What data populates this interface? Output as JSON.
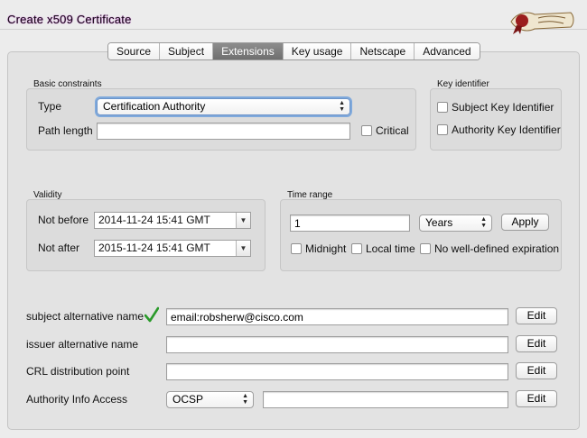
{
  "window": {
    "title": "Create x509 Certificate"
  },
  "tabs": [
    {
      "label": "Source",
      "active": false
    },
    {
      "label": "Subject",
      "active": false
    },
    {
      "label": "Extensions",
      "active": true
    },
    {
      "label": "Key usage",
      "active": false
    },
    {
      "label": "Netscape",
      "active": false
    },
    {
      "label": "Advanced",
      "active": false
    }
  ],
  "basic_constraints": {
    "title": "Basic constraints",
    "type_label": "Type",
    "type_value": "Certification Authority",
    "path_length_label": "Path length",
    "path_length_value": "",
    "critical_label": "Critical",
    "critical_checked": false
  },
  "key_identifier": {
    "title": "Key identifier",
    "subject_label": "Subject Key Identifier",
    "authority_label": "Authority Key Identifier"
  },
  "validity": {
    "title": "Validity",
    "not_before_label": "Not before",
    "not_before_value": "2014-11-24 15:41 GMT",
    "not_after_label": "Not after",
    "not_after_value": "2015-11-24 15:41 GMT"
  },
  "time_range": {
    "title": "Time range",
    "amount": "1",
    "unit": "Years",
    "apply_label": "Apply",
    "midnight_label": "Midnight",
    "local_time_label": "Local time",
    "no_expiration_label": "No well-defined expiration"
  },
  "extensions": {
    "san_label": "subject alternative name",
    "san_value": "email:robsherw@cisco.com",
    "ian_label": "issuer alternative name",
    "ian_value": "",
    "crl_label": "CRL distribution point",
    "crl_value": "",
    "aia_label": "Authority Info Access",
    "aia_method": "OCSP",
    "aia_value": "",
    "edit_label": "Edit"
  },
  "colors": {
    "accent_check": "#2a9a2a",
    "active_tab": "#7a7a7a"
  },
  "icons": {
    "check": "check-icon",
    "logo": "xca-logo"
  }
}
